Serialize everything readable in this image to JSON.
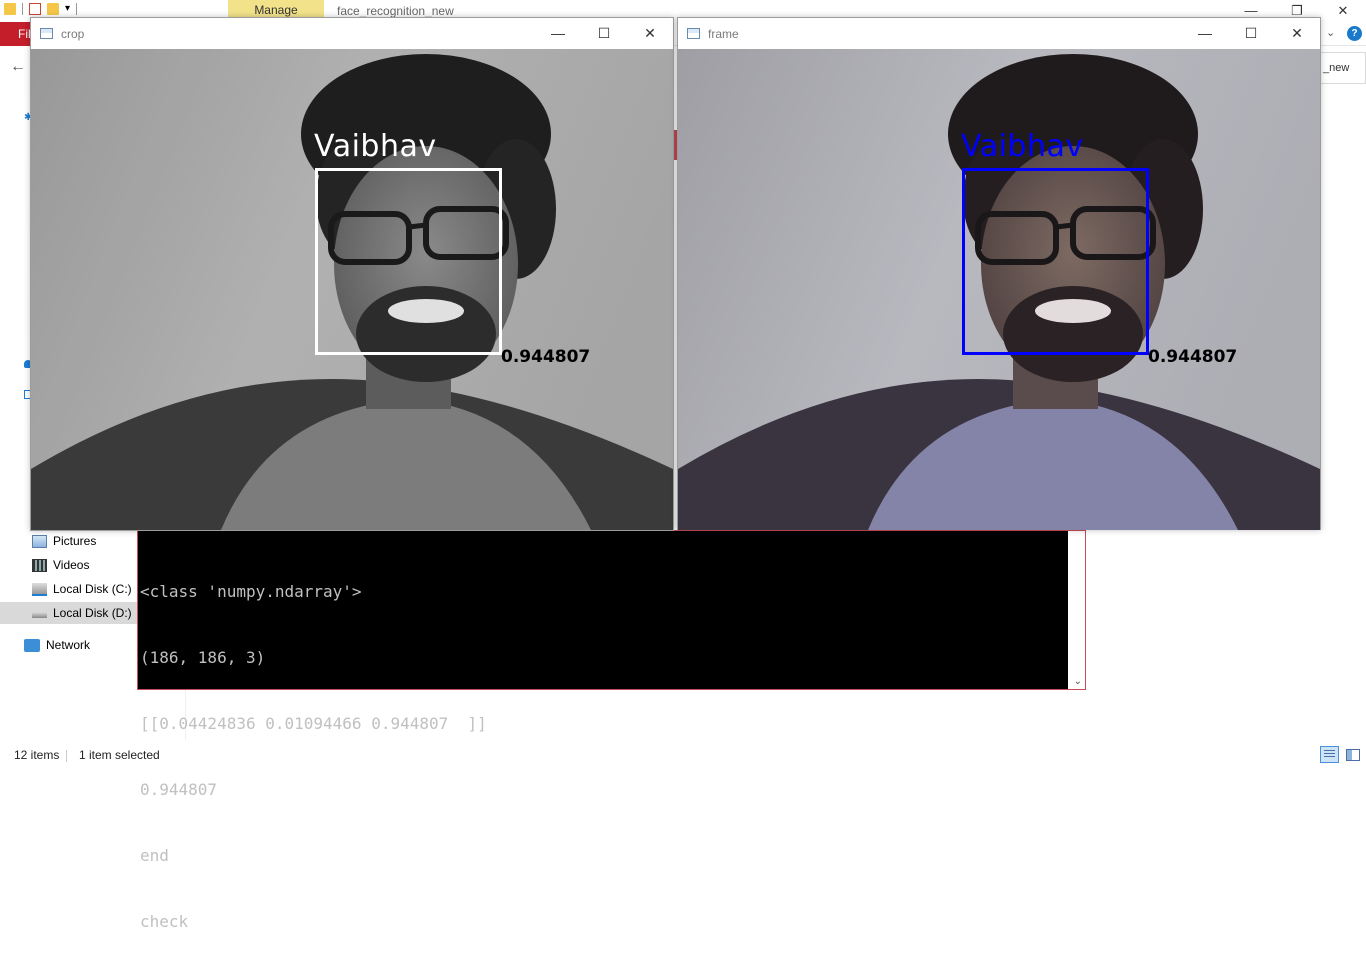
{
  "explorer": {
    "manage_tab": "Manage",
    "folder_title": "face_recognition_new",
    "file_tab": "File",
    "search_partial": "_new",
    "help": "?",
    "nav": [
      {
        "label": "Pictures",
        "icon": "pictures-icon"
      },
      {
        "label": "Videos",
        "icon": "videos-icon"
      },
      {
        "label": "Local Disk (C:)",
        "icon": "local-disk-c-icon"
      },
      {
        "label": "Local Disk (D:)",
        "icon": "local-disk-d-icon",
        "selected": true
      },
      {
        "label": "Network",
        "icon": "network-icon"
      }
    ],
    "status": {
      "count": "12 items",
      "selection": "1 item selected"
    }
  },
  "console": {
    "lines": [
      "<class 'numpy.ndarray'>",
      "(186, 186, 3)",
      "[[0.04424836 0.01094466 0.944807  ]]",
      "0.944807",
      "end",
      "check"
    ]
  },
  "windows": {
    "crop": {
      "title": "crop",
      "label": "Vaibhav",
      "score": "0.944807",
      "label_color": "#ffffff",
      "box_color": "#ffffff"
    },
    "frame": {
      "title": "frame",
      "label": "Vaibhav",
      "score": "0.944807",
      "label_color": "#0000ff",
      "box_color": "#0000ff"
    }
  },
  "colors": {
    "file_tab": "#c41e2b",
    "manage_tab": "#f2e38a",
    "console_bg": "#000000",
    "console_fg": "#c0c0c0"
  }
}
